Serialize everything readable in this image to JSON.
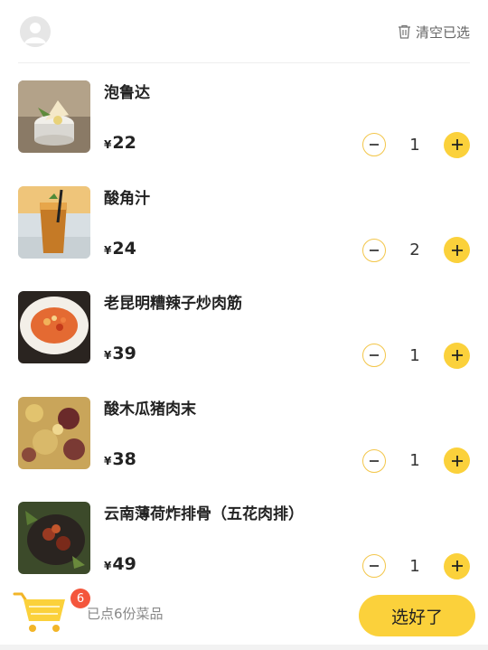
{
  "header": {
    "clear_label": "清空已选"
  },
  "items": [
    {
      "name": "泡鲁达",
      "currency": "¥",
      "price": "22",
      "qty": "1"
    },
    {
      "name": "酸角汁",
      "currency": "¥",
      "price": "24",
      "qty": "2"
    },
    {
      "name": "老昆明糟辣子炒肉筋",
      "currency": "¥",
      "price": "39",
      "qty": "1"
    },
    {
      "name": "酸木瓜猪肉末",
      "currency": "¥",
      "price": "38",
      "qty": "1"
    },
    {
      "name": "云南薄荷炸排骨（五花肉排）",
      "currency": "¥",
      "price": "49",
      "qty": "1"
    }
  ],
  "footer": {
    "cart_count": "6",
    "summary": "已点6份菜品",
    "submit_label": "选好了"
  },
  "colors": {
    "accent": "#fbd13b",
    "badge": "#f4563c"
  }
}
